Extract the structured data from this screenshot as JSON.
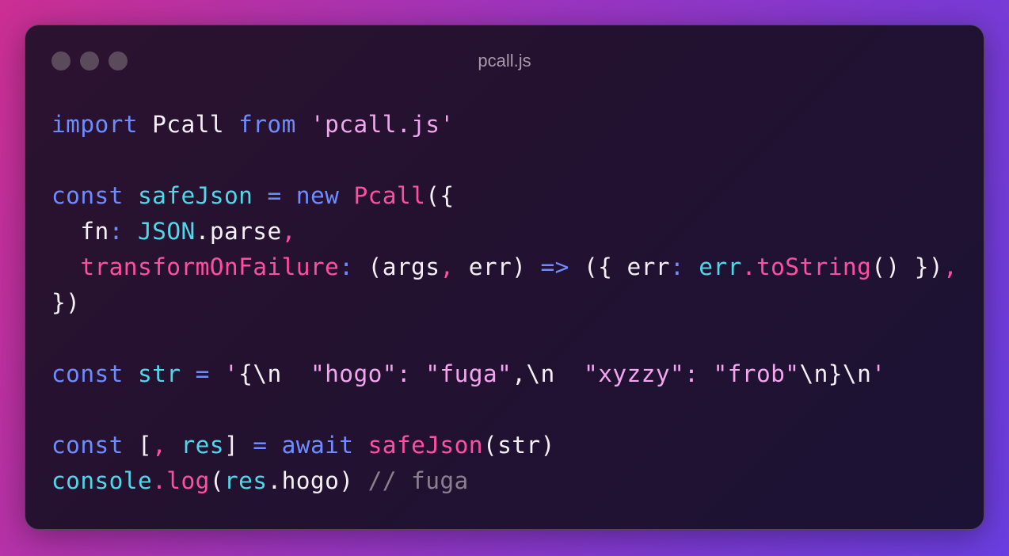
{
  "window": {
    "title": "pcall.js",
    "controls": [
      "close",
      "minimize",
      "maximize"
    ]
  },
  "colors": {
    "keyword": "#6f8cff",
    "pink": "#ff4fa3",
    "cyan": "#4fd8e8",
    "string": "#f2a6ee",
    "text": "#f4f0f5",
    "comment": "#8c7f8d"
  },
  "code": {
    "lines": [
      [
        {
          "c": "kw",
          "t": "import"
        },
        {
          "c": "wh",
          "t": " Pcall "
        },
        {
          "c": "kw",
          "t": "from"
        },
        {
          "c": "wh",
          "t": " "
        },
        {
          "c": "str",
          "t": "'pcall.js'"
        }
      ],
      [],
      [
        {
          "c": "kw",
          "t": "const"
        },
        {
          "c": "wh",
          "t": " "
        },
        {
          "c": "cy",
          "t": "safeJson"
        },
        {
          "c": "wh",
          "t": " "
        },
        {
          "c": "kw",
          "t": "="
        },
        {
          "c": "wh",
          "t": " "
        },
        {
          "c": "kw",
          "t": "new"
        },
        {
          "c": "wh",
          "t": " "
        },
        {
          "c": "pk",
          "t": "Pcall"
        },
        {
          "c": "wh",
          "t": "({"
        }
      ],
      [
        {
          "c": "wh",
          "t": "  fn"
        },
        {
          "c": "kw",
          "t": ":"
        },
        {
          "c": "wh",
          "t": " "
        },
        {
          "c": "cy",
          "t": "JSON"
        },
        {
          "c": "wh",
          "t": ".parse"
        },
        {
          "c": "pk",
          "t": ","
        }
      ],
      [
        {
          "c": "wh",
          "t": "  "
        },
        {
          "c": "pk",
          "t": "transformOnFailure"
        },
        {
          "c": "kw",
          "t": ":"
        },
        {
          "c": "wh",
          "t": " (args"
        },
        {
          "c": "pk",
          "t": ","
        },
        {
          "c": "wh",
          "t": " err) "
        },
        {
          "c": "kw",
          "t": "=>"
        },
        {
          "c": "wh",
          "t": " ({ err"
        },
        {
          "c": "kw",
          "t": ":"
        },
        {
          "c": "wh",
          "t": " "
        },
        {
          "c": "cy",
          "t": "err"
        },
        {
          "c": "pk",
          "t": ".toString"
        },
        {
          "c": "wh",
          "t": "() })"
        },
        {
          "c": "pk",
          "t": ","
        }
      ],
      [
        {
          "c": "wh",
          "t": "})"
        }
      ],
      [],
      [
        {
          "c": "kw",
          "t": "const"
        },
        {
          "c": "wh",
          "t": " "
        },
        {
          "c": "cy",
          "t": "str"
        },
        {
          "c": "wh",
          "t": " "
        },
        {
          "c": "kw",
          "t": "="
        },
        {
          "c": "wh",
          "t": " "
        },
        {
          "c": "str",
          "t": "'"
        },
        {
          "c": "wh",
          "t": "{\\n  "
        },
        {
          "c": "str",
          "t": "\"hogo\": \"fuga\""
        },
        {
          "c": "wh",
          "t": ",\\n  "
        },
        {
          "c": "str",
          "t": "\"xyzzy\": \"frob\""
        },
        {
          "c": "wh",
          "t": "\\n}\\n"
        },
        {
          "c": "str",
          "t": "'"
        }
      ],
      [],
      [
        {
          "c": "kw",
          "t": "const"
        },
        {
          "c": "wh",
          "t": " ["
        },
        {
          "c": "pk",
          "t": ","
        },
        {
          "c": "wh",
          "t": " "
        },
        {
          "c": "cy",
          "t": "res"
        },
        {
          "c": "wh",
          "t": "] "
        },
        {
          "c": "kw",
          "t": "="
        },
        {
          "c": "wh",
          "t": " "
        },
        {
          "c": "kw",
          "t": "await"
        },
        {
          "c": "wh",
          "t": " "
        },
        {
          "c": "pk",
          "t": "safeJson"
        },
        {
          "c": "wh",
          "t": "(str)"
        }
      ],
      [
        {
          "c": "cy",
          "t": "console"
        },
        {
          "c": "pk",
          "t": ".log"
        },
        {
          "c": "wh",
          "t": "("
        },
        {
          "c": "cy",
          "t": "res"
        },
        {
          "c": "wh",
          "t": ".hogo) "
        },
        {
          "c": "cm",
          "t": "// fuga"
        }
      ]
    ]
  }
}
